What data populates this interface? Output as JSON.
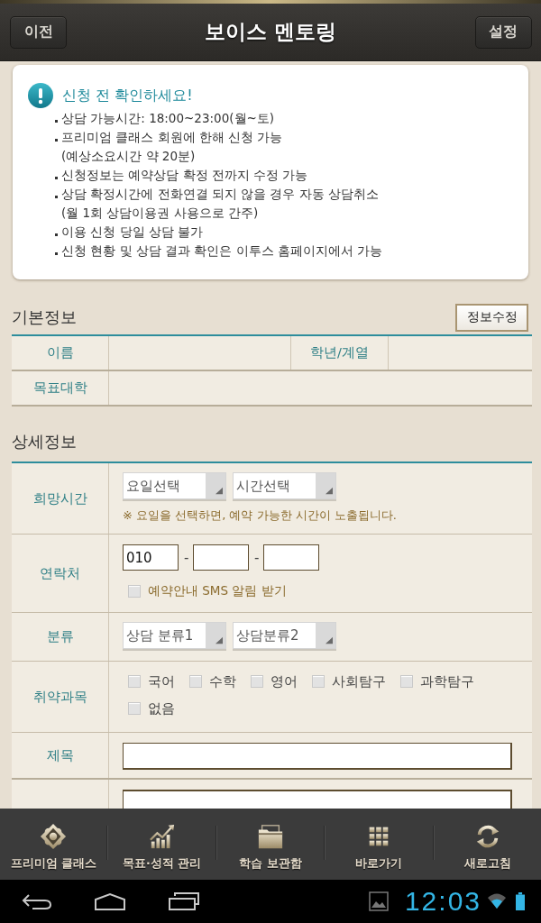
{
  "top_bar": {
    "back_button": "이전",
    "title": "보이스 멘토링",
    "settings_button": "설정"
  },
  "notice": {
    "title": "신청 전 확인하세요!",
    "items": [
      {
        "lines": [
          "상담 가능시간: 18:00~23:00(월~토)"
        ]
      },
      {
        "lines": [
          "프리미엄 클래스 회원에 한해 신청 가능",
          "(예상소요시간 약 20분)"
        ]
      },
      {
        "lines": [
          "신청정보는 예약상담 확정 전까지 수정 가능"
        ]
      },
      {
        "lines": [
          "상담 확정시간에 전화연결 되지 않을 경우 자동 상담취소",
          "(월 1회 상담이용권 사용으로 간주)"
        ]
      },
      {
        "lines": [
          "이용 신청 당일 상담 불가"
        ]
      },
      {
        "lines": [
          "신청 현황 및 상담 결과 확인은 이투스 홈페이지에서 가능"
        ]
      }
    ]
  },
  "basic_info": {
    "title": "기본정보",
    "edit_button": "정보수정",
    "rows": [
      [
        {
          "label": "이름"
        },
        {
          "label": "학년/계열"
        }
      ],
      [
        {
          "label": "목표대학"
        }
      ]
    ]
  },
  "detail_info": {
    "title": "상세정보",
    "rows": [
      {
        "kind": "selects",
        "label": "희망시간",
        "selects": [
          "요일선택",
          "시간선택"
        ],
        "hint": "※ 요일을 선택하면, 예약 가능한 시간이 노출됩니다."
      },
      {
        "kind": "phone",
        "label": "연락처",
        "first_value": "010",
        "separators": [
          "-",
          "-"
        ],
        "sms_option": {
          "label": "예약안내 SMS 알림 받기",
          "checked": false
        }
      },
      {
        "kind": "selects",
        "label": "분류",
        "selects": [
          "상담 분류1",
          "상담분류2"
        ]
      },
      {
        "kind": "checkboxes",
        "label": "취약과목",
        "options": [
          {
            "label": "국어",
            "checked": false
          },
          {
            "label": "수학",
            "checked": false
          },
          {
            "label": "영어",
            "checked": false
          },
          {
            "label": "사회탐구",
            "checked": false
          },
          {
            "label": "과학탐구",
            "checked": false
          },
          {
            "label": "없음",
            "checked": false
          }
        ]
      },
      {
        "kind": "text",
        "label": "제목"
      },
      {
        "kind": "textarea"
      }
    ]
  },
  "bottom_nav": {
    "items": [
      {
        "kind": "premium",
        "label": "프리미엄 클래스"
      },
      {
        "kind": "chart",
        "label": "목표·성적 관리"
      },
      {
        "kind": "folder",
        "label": "학습 보관함"
      },
      {
        "kind": "grid",
        "label": "바로가기"
      },
      {
        "kind": "refresh",
        "label": "새로고침"
      }
    ]
  },
  "status_bar": {
    "time": "12:03"
  }
}
